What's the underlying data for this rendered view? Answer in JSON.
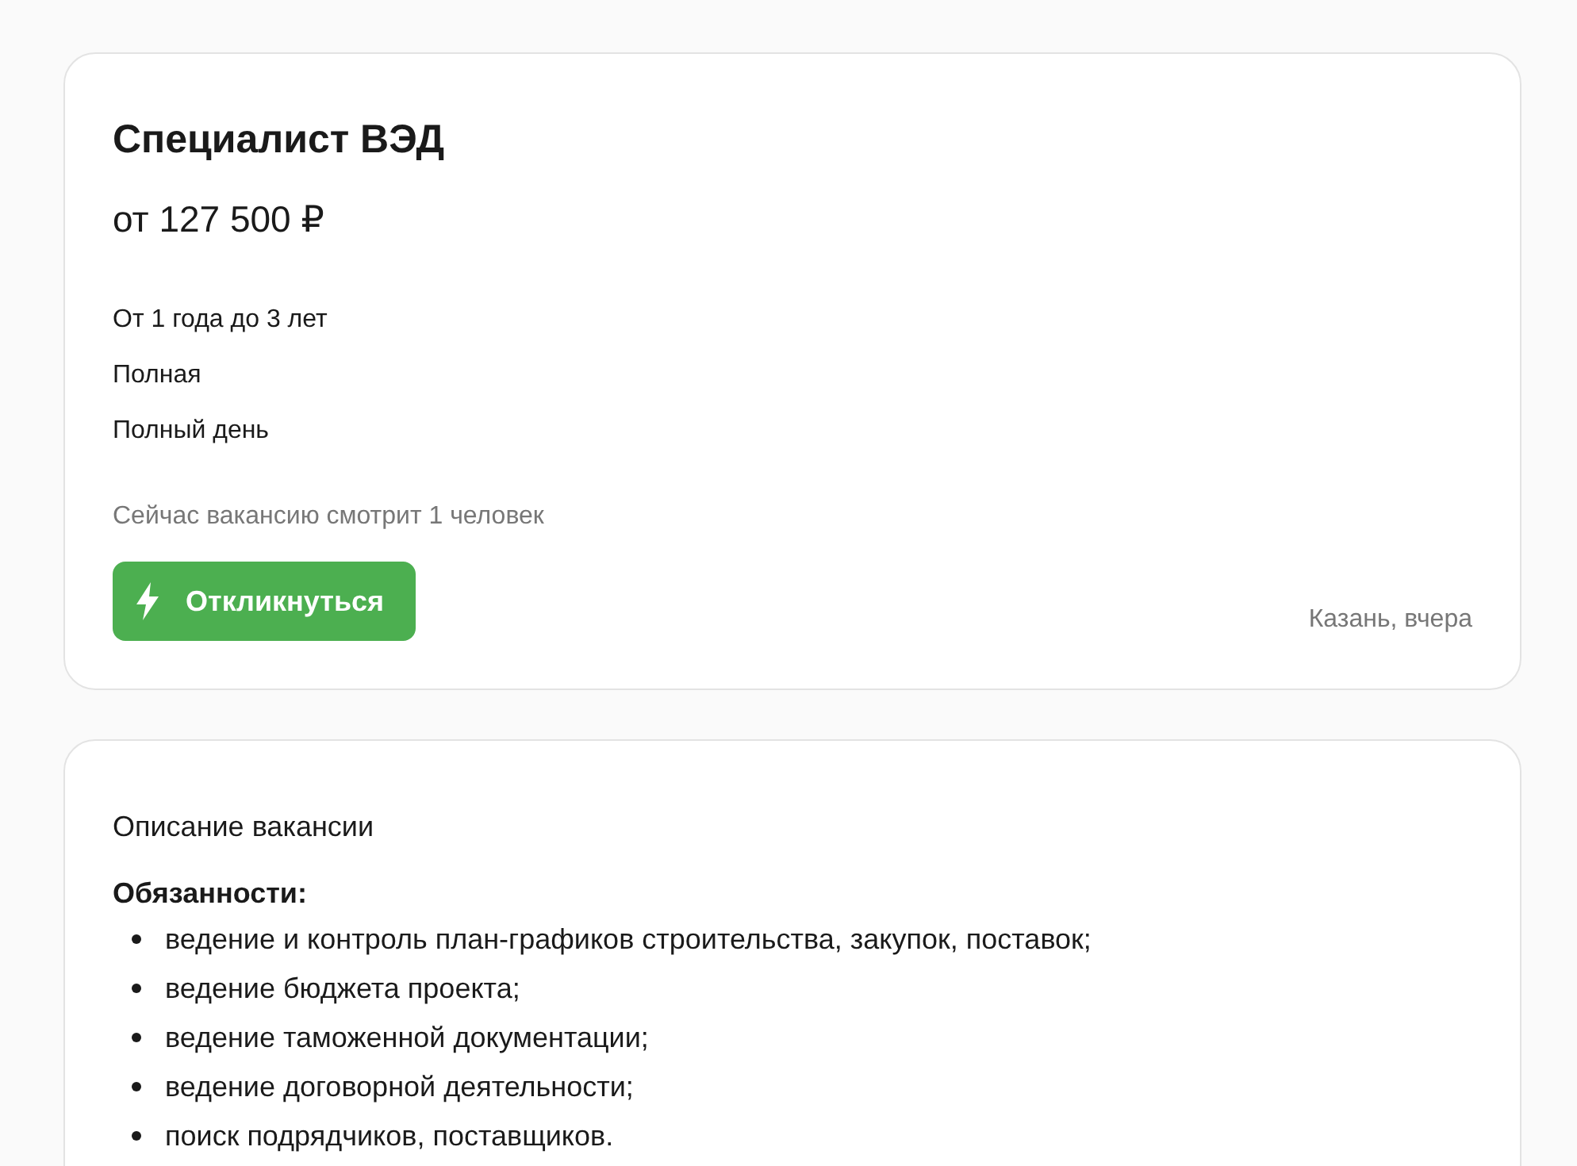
{
  "vacancy": {
    "title": "Специалист ВЭД",
    "salary": "от 127 500 ₽",
    "details": [
      "От 1 года до 3 лет",
      "Полная",
      "Полный день"
    ],
    "viewers": "Сейчас вакансию смотрит 1 человек",
    "apply_button": "Откликнуться",
    "location_date": "Казань, вчера"
  },
  "description": {
    "heading": "Описание вакансии",
    "sections": [
      {
        "title": "Обязанности:",
        "items": [
          "ведение и контроль план-графиков строительства, закупок, поставок;",
          "ведение бюджета проекта;",
          "ведение таможенной документации;",
          "ведение договорной деятельности;",
          "поиск подрядчиков, поставщиков."
        ]
      }
    ]
  }
}
